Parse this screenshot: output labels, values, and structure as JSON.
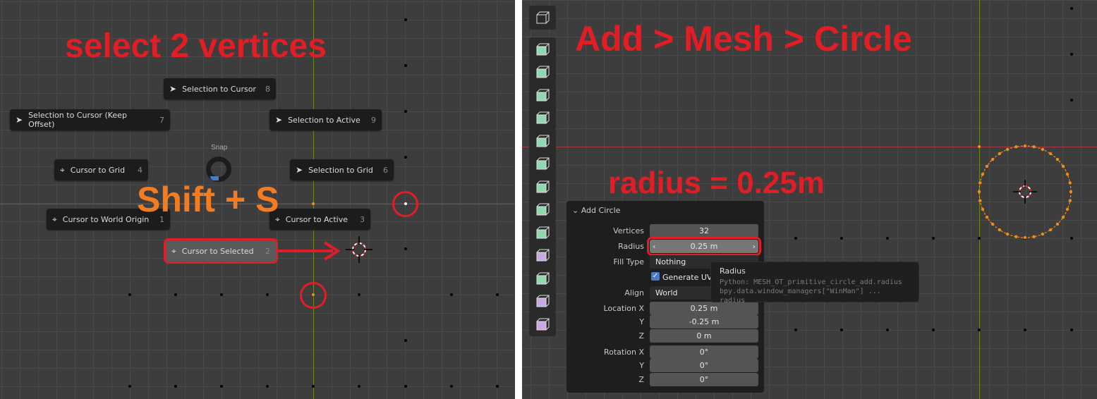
{
  "left": {
    "title": "select 2 vertices",
    "shortcut": "Shift + S",
    "pie_title": "Snap",
    "pie_items": [
      {
        "label": "Selection to Cursor",
        "key": "8",
        "icon": "cursor-arrow-icon"
      },
      {
        "label": "Selection to Cursor (Keep Offset)",
        "key": "7",
        "icon": "cursor-arrow-icon"
      },
      {
        "label": "Selection to Active",
        "key": "9",
        "icon": "cursor-arrow-icon"
      },
      {
        "label": "Cursor to Grid",
        "key": "4",
        "icon": "3d-cursor-icon"
      },
      {
        "label": "Selection to Grid",
        "key": "6",
        "icon": "cursor-arrow-icon"
      },
      {
        "label": "Cursor to World Origin",
        "key": "1",
        "icon": "3d-cursor-icon"
      },
      {
        "label": "Cursor to Active",
        "key": "3",
        "icon": "3d-cursor-icon"
      },
      {
        "label": "Cursor to Selected",
        "key": "2",
        "icon": "3d-cursor-icon",
        "highlighted": true
      }
    ]
  },
  "right": {
    "title": "Add > Mesh > Circle",
    "note": "radius = 0.25m",
    "panel": {
      "title": "Add Circle",
      "vertices_label": "Vertices",
      "vertices": "32",
      "radius_label": "Radius",
      "radius": "0.25 m",
      "fill_label": "Fill Type",
      "fill": "Nothing",
      "uvs_label": "Generate UVs",
      "uvs_checked": true,
      "align_label": "Align",
      "align": "World",
      "loc_label": "Location X",
      "loc_x": "0.25 m",
      "y_label": "Y",
      "loc_y": "-0.25 m",
      "z_label": "Z",
      "loc_z": "0 m",
      "rot_label": "Rotation X",
      "rot_x": "0°",
      "rot_y": "0°",
      "rot_z": "0°"
    },
    "tooltip": {
      "title": "Radius",
      "line1": "Python: MESH_OT_primitive_circle_add.radius",
      "line2": "bpy.data.window_managers[\"WinMan\"] ... radius"
    },
    "tools": [
      "measure",
      "add-cube",
      "extrude",
      "inset",
      "bevel",
      "loop-cut",
      "knife",
      "poly-build",
      "spin",
      "smooth",
      "edge-slide",
      "shrink-fatten",
      "shear",
      "rip"
    ]
  },
  "colors": {
    "annotation_red": "#e11d25",
    "annotation_orange": "#f47c20",
    "vertex_orange": "#f08c1a",
    "tool_green": "#8fd9b0",
    "tool_purple": "#c9a9e0"
  }
}
